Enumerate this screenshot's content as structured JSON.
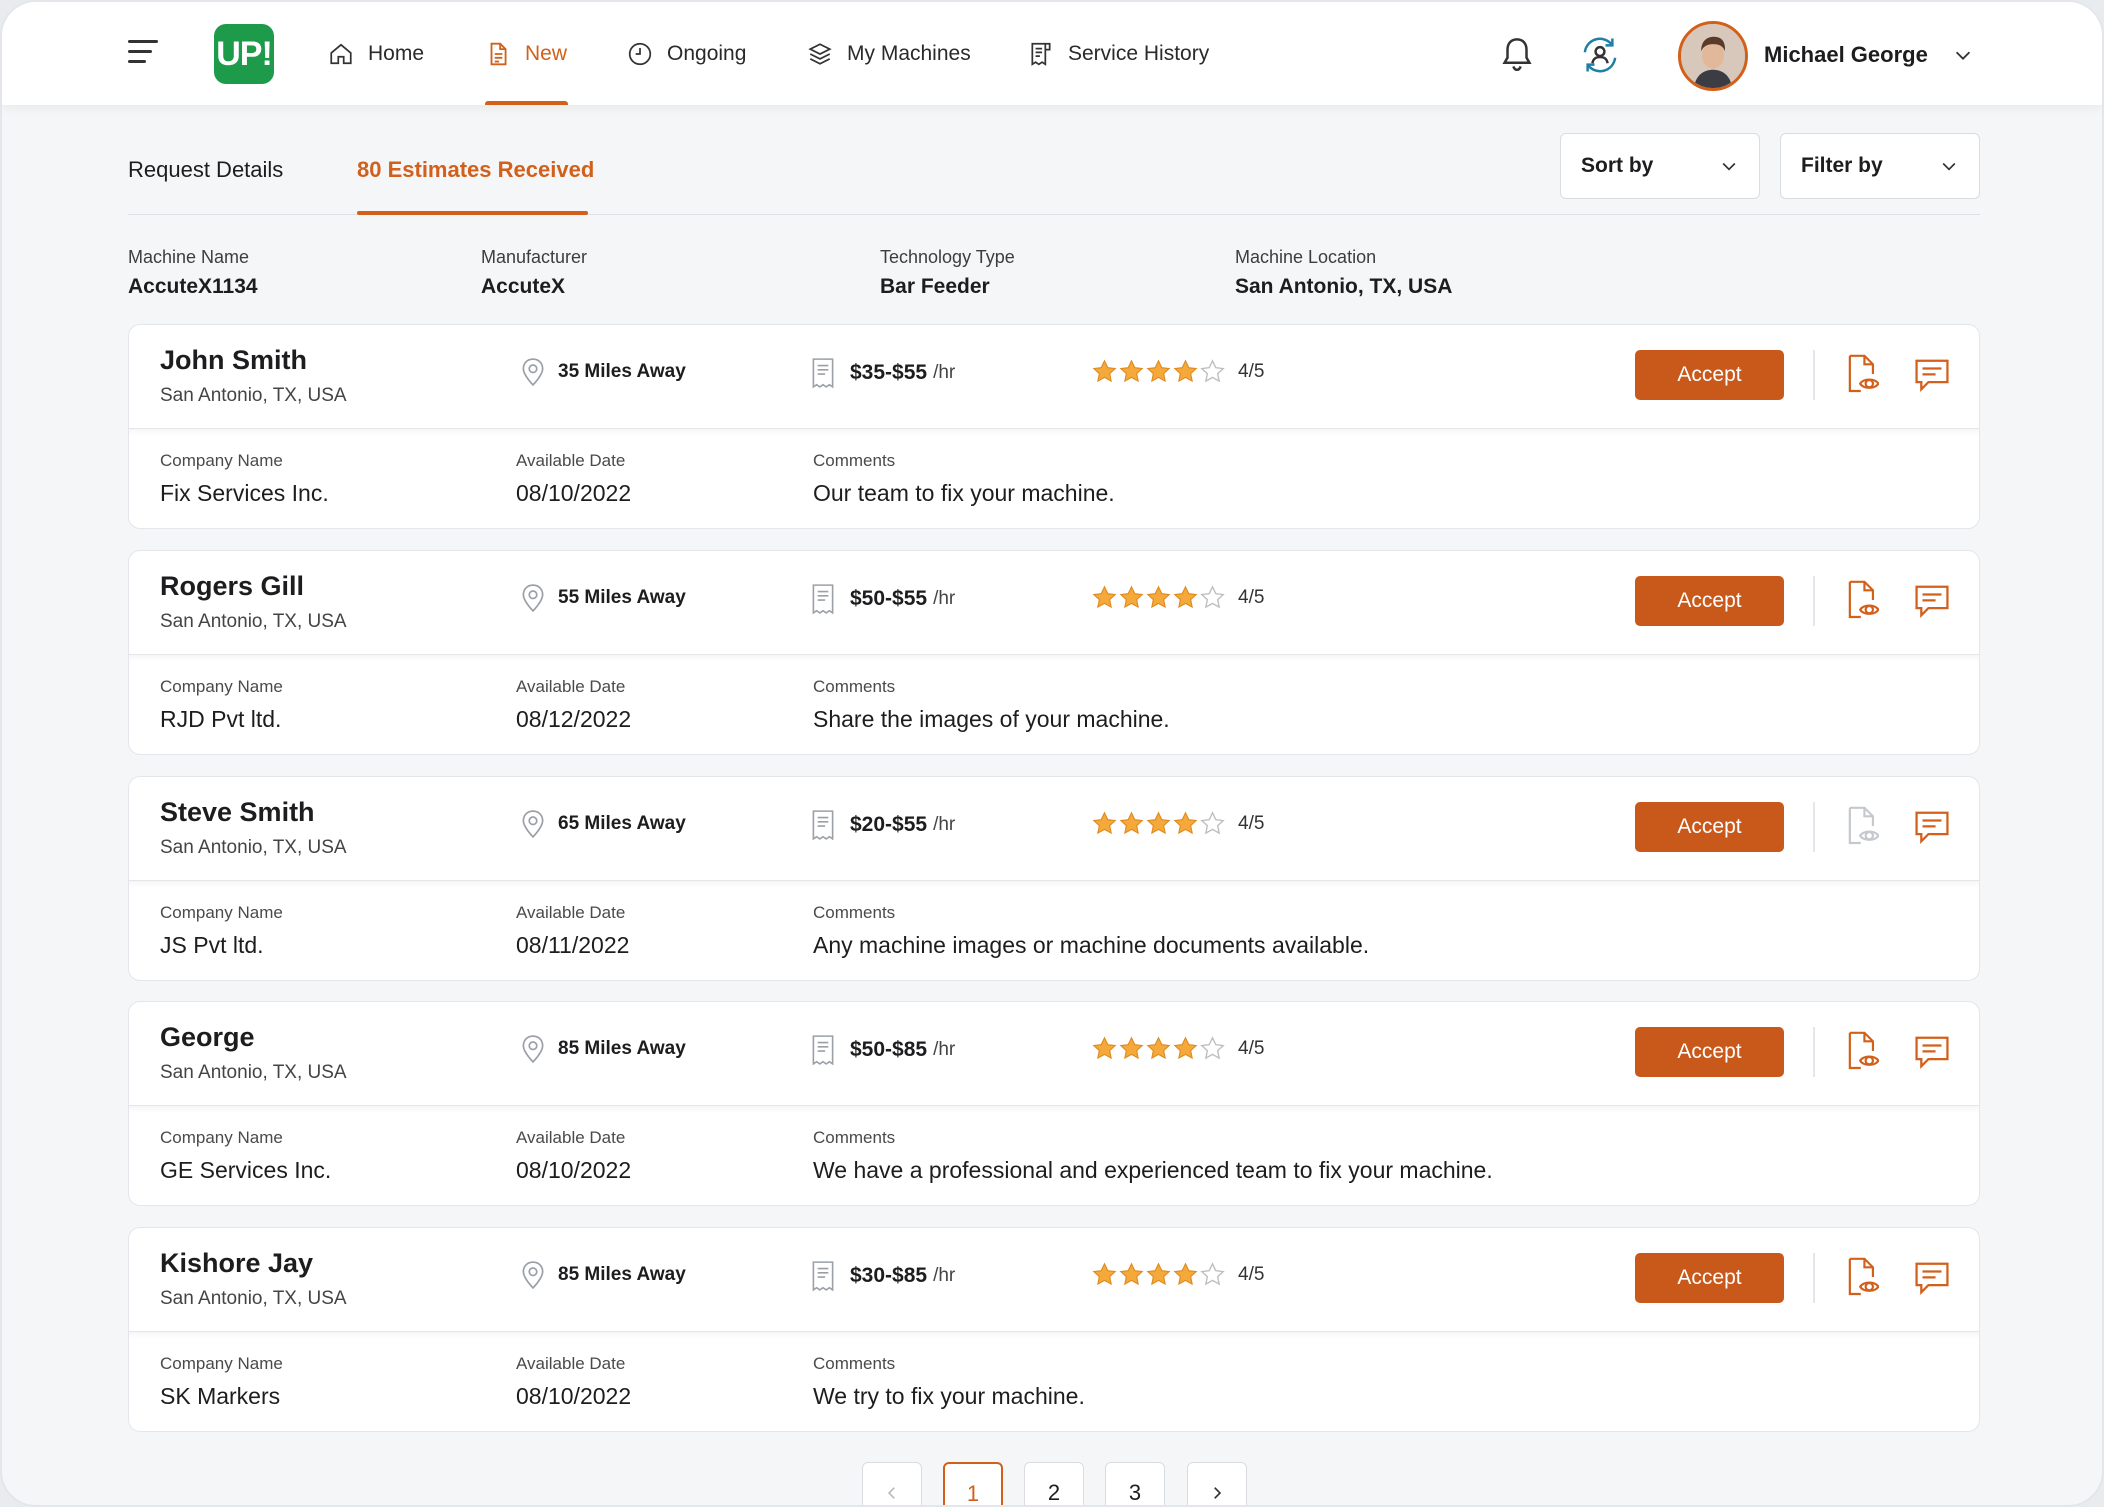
{
  "nav": {
    "items": [
      {
        "label": "Home"
      },
      {
        "label": "New"
      },
      {
        "label": "Ongoing"
      },
      {
        "label": "My Machines"
      },
      {
        "label": "Service History"
      }
    ],
    "logo_text": "UP!",
    "user_name": "Michael George",
    "accent_color": "#d2601a"
  },
  "tabs": [
    {
      "label": "Request Details"
    },
    {
      "label": "80 Estimates Received"
    }
  ],
  "sort_label": "Sort by",
  "filter_label": "Filter by",
  "machine": {
    "name_label": "Machine Name",
    "name_value": "AccuteX1134",
    "manufacturer_label": "Manufacturer",
    "manufacturer_value": "AccuteX",
    "technology_label": "Technology Type",
    "technology_value": "Bar Feeder",
    "location_label": "Machine Location",
    "location_value": "San Antonio, TX, USA"
  },
  "card_labels": {
    "company": "Company Name",
    "date": "Available Date",
    "comments": "Comments",
    "accept": "Accept",
    "unit": "/hr"
  },
  "estimates": [
    {
      "name": "John Smith",
      "location": "San Antonio, TX, USA",
      "distance": "35 Miles Away",
      "price": "$35-$55",
      "rating_text": "4/5",
      "rating": 4,
      "company": "Fix Services Inc.",
      "date": "08/10/2022",
      "comment": "Our team to fix your machine."
    },
    {
      "name": "Rogers Gill",
      "location": "San Antonio, TX, USA",
      "distance": "55 Miles Away",
      "price": "$50-$55",
      "rating_text": "4/5",
      "rating": 4,
      "company": "RJD Pvt ltd.",
      "date": "08/12/2022",
      "comment": "Share the images of your machine."
    },
    {
      "name": "Steve Smith",
      "location": "San Antonio, TX, USA",
      "distance": "65 Miles Away",
      "price": "$20-$55",
      "rating_text": "4/5",
      "rating": 4,
      "company": "JS Pvt ltd.",
      "date": "08/11/2022",
      "comment": "Any machine images or machine documents available."
    },
    {
      "name": "George",
      "location": "San Antonio, TX, USA",
      "distance": "85 Miles Away",
      "price": "$50-$85",
      "rating_text": "4/5",
      "rating": 4,
      "company": "GE Services Inc.",
      "date": "08/10/2022",
      "comment": "We have a professional and experienced team to fix your machine."
    },
    {
      "name": "Kishore Jay",
      "location": "San Antonio, TX, USA",
      "distance": "85 Miles Away",
      "price": "$30-$85",
      "rating_text": "4/5",
      "rating": 4,
      "company": "SK Markers",
      "date": "08/10/2022",
      "comment": "We try to fix your machine."
    }
  ],
  "pagination": {
    "pages": [
      "1",
      "2",
      "3"
    ],
    "current": "1"
  }
}
